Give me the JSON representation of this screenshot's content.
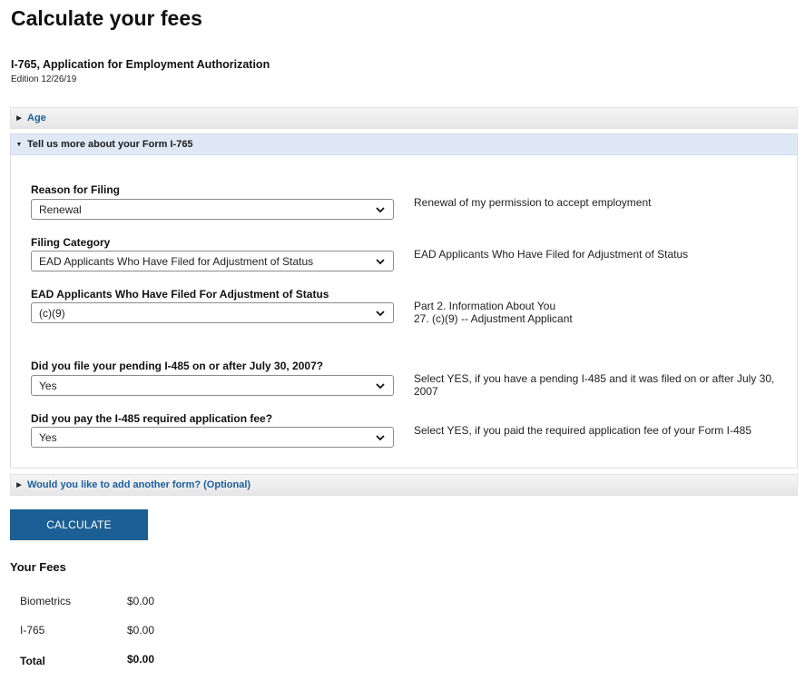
{
  "page": {
    "title": "Calculate your fees",
    "form_name": "I-765, Application for Employment Authorization",
    "edition": "Edition 12/26/19"
  },
  "accordion": {
    "age": {
      "label": "Age"
    },
    "form_details": {
      "label": "Tell us more about your Form I-765"
    },
    "add_form": {
      "label": "Would you like to add another form? (Optional)"
    }
  },
  "fields": {
    "reason": {
      "label": "Reason for Filing",
      "value": "Renewal",
      "help": "Renewal of my permission to accept employment"
    },
    "category": {
      "label": "Filing Category",
      "value": "EAD Applicants Who Have Filed for Adjustment of Status",
      "help": "EAD Applicants Who Have Filed for Adjustment of Status"
    },
    "subcategory": {
      "label": "EAD Applicants Who Have Filed For Adjustment of Status",
      "value": "(c)(9)",
      "help": "Part 2. Information About You\n 27. (c)(9) -- Adjustment Applicant"
    },
    "i485_date": {
      "label": "Did you file your pending I-485 on or after July 30, 2007?",
      "value": "Yes",
      "help": "Select YES, if you have a pending I-485 and it was filed on or after July 30, 2007"
    },
    "i485_fee": {
      "label": "Did you pay the I-485 required application fee?",
      "value": "Yes",
      "help": "Select YES, if you paid the required application fee of your Form I-485"
    }
  },
  "calculate_button": {
    "label": "CALCULATE"
  },
  "fees": {
    "heading": "Your Fees",
    "rows": [
      {
        "name": "Biometrics",
        "amount": "$0.00"
      },
      {
        "name": "I-765",
        "amount": "$0.00"
      }
    ],
    "total": {
      "name": "Total",
      "amount": "$0.00"
    }
  },
  "colors": {
    "primary_button": "#1c5f95",
    "link": "#1a5fa0",
    "expanded_header": "#dfe9f6"
  },
  "icons": {
    "collapsed": "caret-right-icon",
    "expanded": "caret-down-icon",
    "select": "chevron-down-icon"
  }
}
